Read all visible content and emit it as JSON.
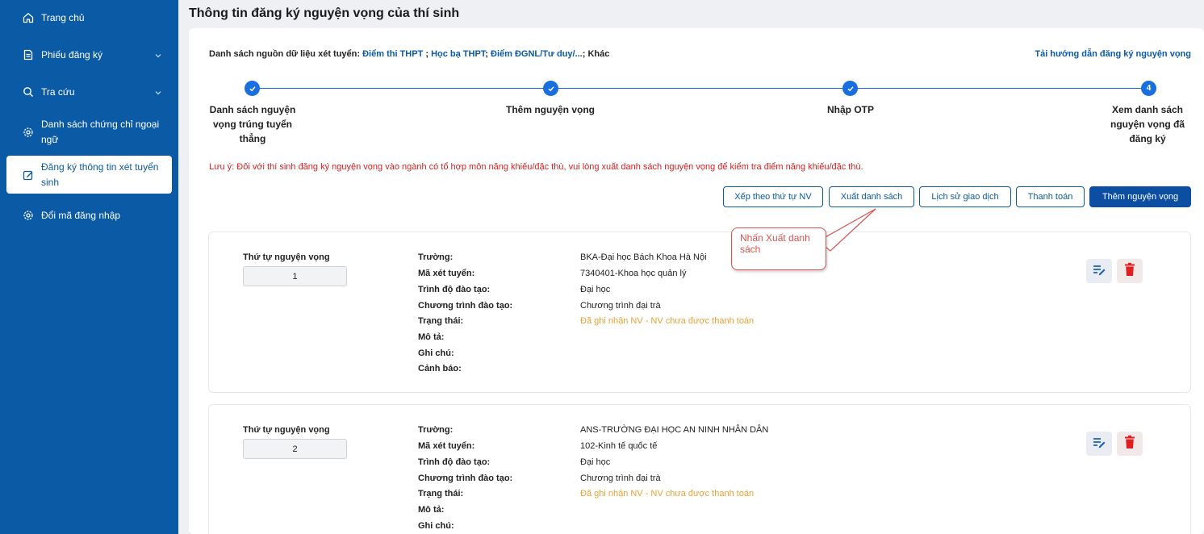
{
  "sidebar": {
    "items": [
      {
        "label": "Trang chủ",
        "icon": "home-icon"
      },
      {
        "label": "Phiếu đăng ký",
        "icon": "document-icon"
      },
      {
        "label": "Tra cứu",
        "icon": "search-icon"
      },
      {
        "label": "Danh sách chứng chỉ ngoại ngữ",
        "icon": "gear-icon"
      },
      {
        "label": "Đăng ký thông tin xét tuyển sinh",
        "icon": "edit-icon"
      },
      {
        "label": "Đổi mã đăng nhập",
        "icon": "gear-icon"
      }
    ]
  },
  "header": {
    "title": "Thông tin đăng ký nguyện vọng của thí sinh"
  },
  "sources": {
    "prefix": "Danh sách nguồn dữ liệu xét tuyển:",
    "item1": "Điểm thi THPT",
    "sep1": " ; ",
    "item2": "Học bạ THPT",
    "sep2": "; ",
    "item3": "Điểm ĐGNL/Tư duy/...",
    "sep3": "; Khác"
  },
  "guide_link": "Tải hướng dẫn đăng ký nguyện vọng",
  "steps": [
    {
      "label": "Danh sách nguyện vọng trúng tuyển thẳng",
      "state": "done"
    },
    {
      "label": "Thêm nguyện vọng",
      "state": "done"
    },
    {
      "label": "Nhập OTP",
      "state": "done"
    },
    {
      "label": "Xem danh sách nguyện vọng đã đăng ký",
      "state": "current",
      "number": "4"
    }
  ],
  "note": "Lưu ý: Đối với thí sinh đăng ký nguyện vọng vào ngành có tổ hợp môn năng khiếu/đặc thù, vui lòng xuất danh sách nguyện vọng để kiểm tra điểm năng khiếu/đặc thù.",
  "toolbar": {
    "sort_label": "Xếp theo thứ tự NV",
    "export_label": "Xuất danh sách",
    "history_label": "Lịch sử giao dịch",
    "pay_label": "Thanh toán",
    "add_label": "Thêm nguyện vọng"
  },
  "callout": {
    "text": "Nhấn Xuất danh sách"
  },
  "field_labels": {
    "order": "Thứ tự nguyện vọng",
    "school": "Trường:",
    "code": "Mã xét tuyển:",
    "level": "Trình độ đào tạo:",
    "program": "Chương trình đào tạo:",
    "status": "Trạng thái:",
    "desc": "Mô tả:",
    "note": "Ghi chú:",
    "warning": "Cảnh báo:"
  },
  "wishes": [
    {
      "order": "1",
      "school": "BKA-Đại học Bách Khoa Hà Nội",
      "code": "7340401-Khoa học quản lý",
      "level": "Đại học",
      "program": "Chương trình đại trà",
      "status": "Đã ghi nhận NV - NV chưa được thanh toán"
    },
    {
      "order": "2",
      "school": "ANS-TRƯỜNG ĐẠI HỌC AN NINH NHÂN DÂN",
      "code": "102-Kinh tế quốc tế",
      "level": "Đại học",
      "program": "Chương trình đại trà",
      "status": "Đã ghi nhận NV - NV chưa được thanh toán"
    }
  ],
  "colors": {
    "sidebar": "#0b5aa5",
    "accent": "#1a6fe0",
    "primary_button": "#0b4ea2",
    "note": "#e02020",
    "status": "#f0a030",
    "delete": "#e02020"
  }
}
